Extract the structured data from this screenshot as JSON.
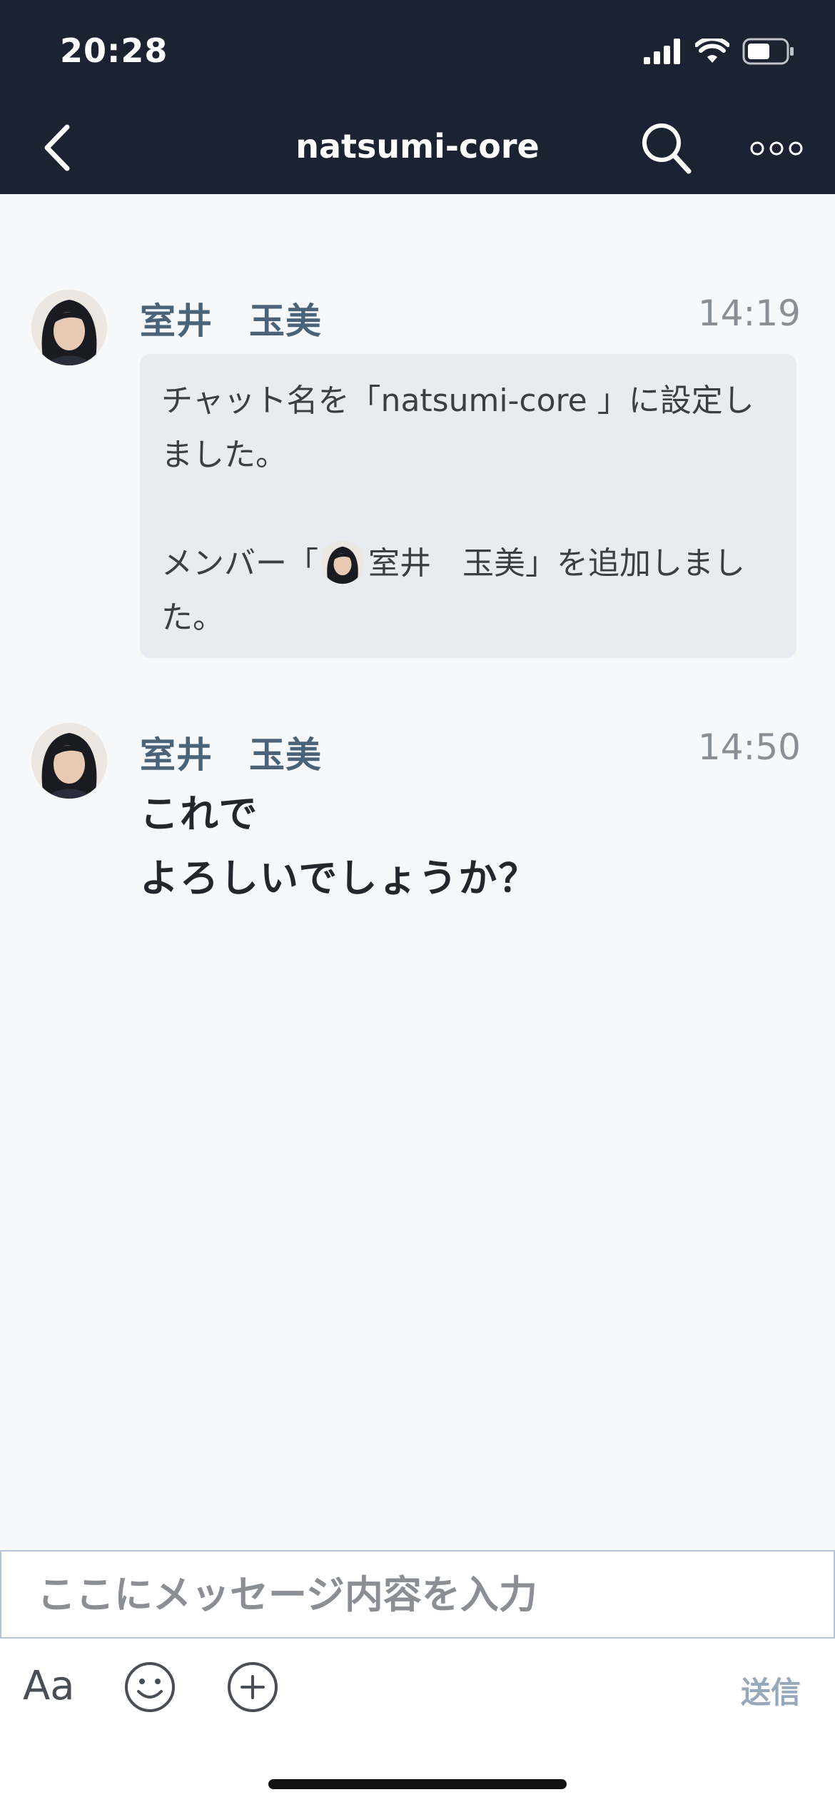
{
  "status_bar": {
    "time": "20:28"
  },
  "nav": {
    "title": "natsumi-core"
  },
  "messages": [
    {
      "sender": "室井　玉美",
      "time": "14:19",
      "system_line1": "チャット名を「natsumi-core 」に設定しました。",
      "system_line2_prefix": "メンバー「",
      "system_line2_name": "室井　玉美",
      "system_line2_suffix": "」を追加しました。"
    },
    {
      "sender": "室井　玉美",
      "time": "14:50",
      "text": "これで\nよろしいでしょうか？"
    }
  ],
  "composer": {
    "placeholder": "ここにメッセージ内容を入力"
  },
  "toolbar": {
    "aa_label": "Aa",
    "send_label": "送信"
  },
  "colors": {
    "header_bg": "#1b2232",
    "sender": "#4b6378",
    "send": "#98a8bb"
  }
}
